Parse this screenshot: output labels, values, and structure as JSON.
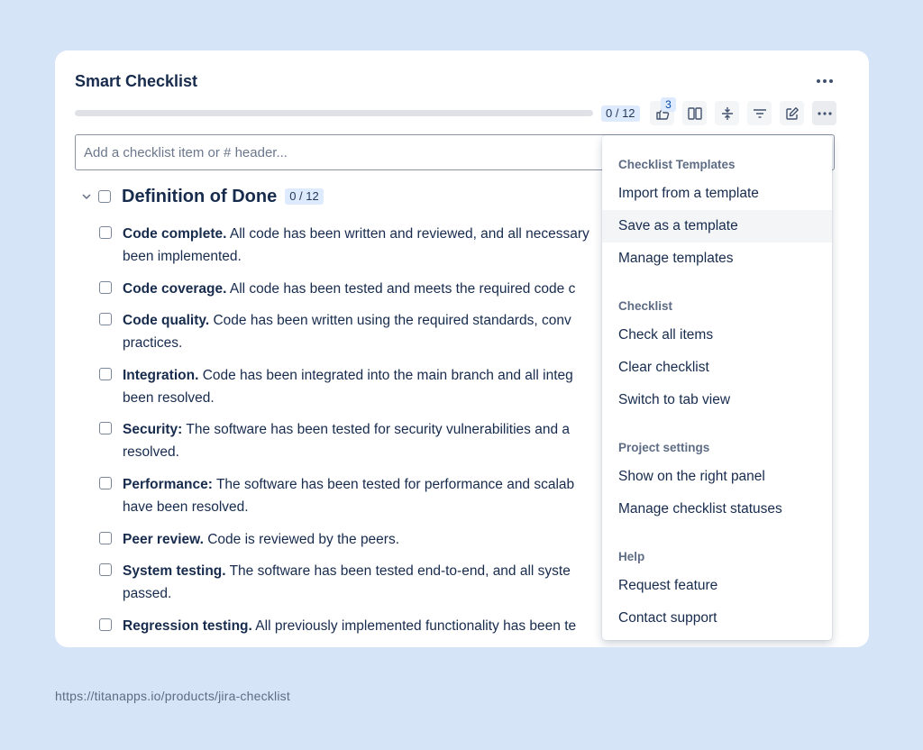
{
  "card": {
    "title": "Smart Checklist",
    "progress_fraction": 0,
    "counter": "0 / 12",
    "toolbar_badge": "3",
    "input_placeholder": "Add a checklist item or # header..."
  },
  "section": {
    "title": "Definition of Done",
    "counter": "0 / 12"
  },
  "items": [
    {
      "bold": "Code complete.",
      "text": " All code has been written and reviewed, and all necessary",
      "text2": "been implemented."
    },
    {
      "bold": "Code coverage.",
      "text": " All code has been tested and meets the required code c",
      "text2": ""
    },
    {
      "bold": "Code quality.",
      "text": " Code has been written using the required standards, conv",
      "text2": "practices."
    },
    {
      "bold": "Integration.",
      "text": " Code has been integrated into the main branch and all integ",
      "text2": "been resolved."
    },
    {
      "bold": "Security:",
      "text": " The software has been tested for security vulnerabilities and a",
      "text2": "resolved."
    },
    {
      "bold": "Performance:",
      "text": " The software has been tested for performance and scalab",
      "text2": "have been resolved."
    },
    {
      "bold": "Peer review.",
      "text": " Code is reviewed by the peers.",
      "text2": ""
    },
    {
      "bold": "System testing.",
      "text": " The software has been tested end-to-end, and all syste",
      "text2": "passed."
    },
    {
      "bold": "Regression testing.",
      "text": " All previously implemented functionality has been te",
      "text2": ""
    }
  ],
  "menu": {
    "templates_heading": "Checklist Templates",
    "import_template": "Import from a template",
    "save_template": "Save as a template",
    "manage_templates": "Manage templates",
    "checklist_heading": "Checklist",
    "check_all": "Check all items",
    "clear_checklist": "Clear checklist",
    "switch_tab_view": "Switch to tab view",
    "project_heading": "Project settings",
    "show_right_panel": "Show on the right panel",
    "manage_statuses": "Manage checklist statuses",
    "help_heading": "Help",
    "request_feature": "Request feature",
    "contact_support": "Contact support"
  },
  "footer": {
    "url": "https://titanapps.io/products/jira-checklist"
  },
  "icons": {
    "more": "more-horizontal-icon",
    "thumbs_up": "thumbs-up-icon",
    "columns": "columns-icon",
    "collapse": "collapse-icon",
    "filter": "filter-icon",
    "edit": "edit-icon",
    "chevron": "chevron-down-icon"
  }
}
